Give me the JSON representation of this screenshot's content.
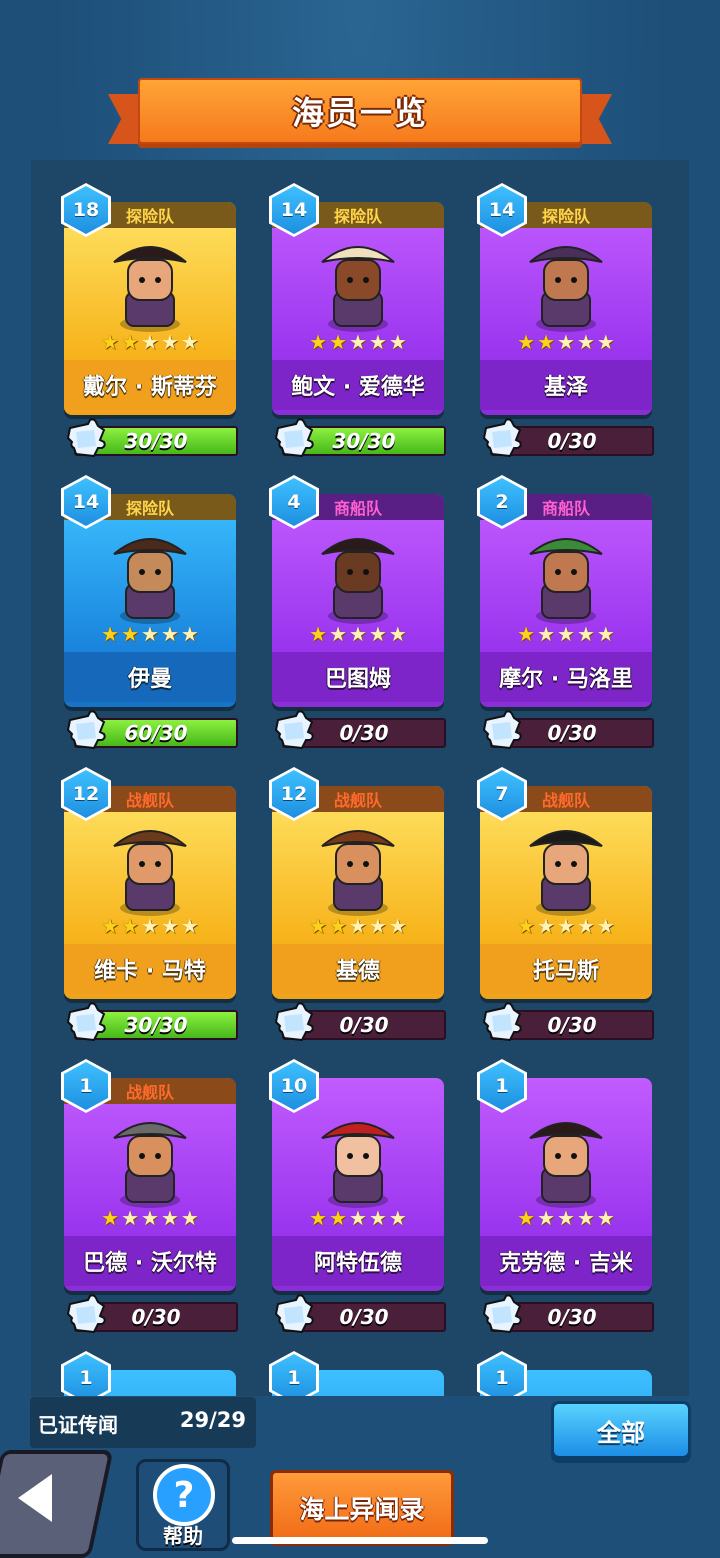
{
  "title": "海员一览",
  "crew": [
    {
      "level": "18",
      "team": "探险队",
      "team_type": "explore",
      "rarity": "gold",
      "stars": 2,
      "name": "戴尔 · 斯蒂芬",
      "progress_text": "30/30",
      "progress": 1.0,
      "icon": "pirate-captain-icon"
    },
    {
      "level": "14",
      "team": "探险队",
      "team_type": "explore",
      "rarity": "purple",
      "stars": 2,
      "name": "鲍文 · 爱德华",
      "progress_text": "30/30",
      "progress": 1.0,
      "icon": "turban-man-icon"
    },
    {
      "level": "14",
      "team": "探险队",
      "team_type": "explore",
      "rarity": "purple",
      "stars": 2,
      "name": "基泽",
      "progress_text": "0/30",
      "progress": 0,
      "icon": "wizard-icon"
    },
    {
      "level": "14",
      "team": "探险队",
      "team_type": "explore",
      "rarity": "blue",
      "stars": 2,
      "name": "伊曼",
      "progress_text": "60/30",
      "progress": 1.0,
      "icon": "curly-hair-icon"
    },
    {
      "level": "4",
      "team": "商船队",
      "team_type": "merchant",
      "rarity": "purple",
      "stars": 1,
      "name": "巴图姆",
      "progress_text": "0/30",
      "progress": 0,
      "icon": "braid-lady-icon"
    },
    {
      "level": "2",
      "team": "商船队",
      "team_type": "merchant",
      "rarity": "purple",
      "stars": 1,
      "name": "摩尔 · 马洛里",
      "progress_text": "0/30",
      "progress": 0,
      "icon": "feather-hat-icon"
    },
    {
      "level": "12",
      "team": "战舰队",
      "team_type": "warship",
      "rarity": "gold",
      "stars": 2,
      "name": "维卡 · 马特",
      "progress_text": "30/30",
      "progress": 1.0,
      "icon": "headband-warrior-icon"
    },
    {
      "level": "12",
      "team": "战舰队",
      "team_type": "warship",
      "rarity": "gold",
      "stars": 2,
      "name": "基德",
      "progress_text": "0/30",
      "progress": 0,
      "icon": "crowned-king-icon"
    },
    {
      "level": "7",
      "team": "战舰队",
      "team_type": "warship",
      "rarity": "gold",
      "stars": 1,
      "name": "托马斯",
      "progress_text": "0/30",
      "progress": 0,
      "icon": "skull-hat-pirate-icon"
    },
    {
      "level": "1",
      "team": "战舰队",
      "team_type": "warship",
      "rarity": "purple",
      "stars": 1,
      "name": "巴德 · 沃尔特",
      "progress_text": "0/30",
      "progress": 0,
      "icon": "viking-icon"
    },
    {
      "level": "10",
      "team": "",
      "team_type": "none",
      "rarity": "purple",
      "stars": 2,
      "name": "阿特伍德",
      "progress_text": "0/30",
      "progress": 0,
      "icon": "red-hair-lady-icon"
    },
    {
      "level": "1",
      "team": "",
      "team_type": "none",
      "rarity": "purple",
      "stars": 1,
      "name": "克劳德 · 吉米",
      "progress_text": "0/30",
      "progress": 0,
      "icon": "pirate-captain-icon"
    }
  ],
  "partial_levels": [
    "1",
    "1",
    "1"
  ],
  "footer": {
    "proved_label": "已证传闻",
    "proved_count": "29/29",
    "all_button": "全部",
    "help_label": "帮助",
    "help_icon": "?",
    "sea_button": "海上异闻录"
  }
}
